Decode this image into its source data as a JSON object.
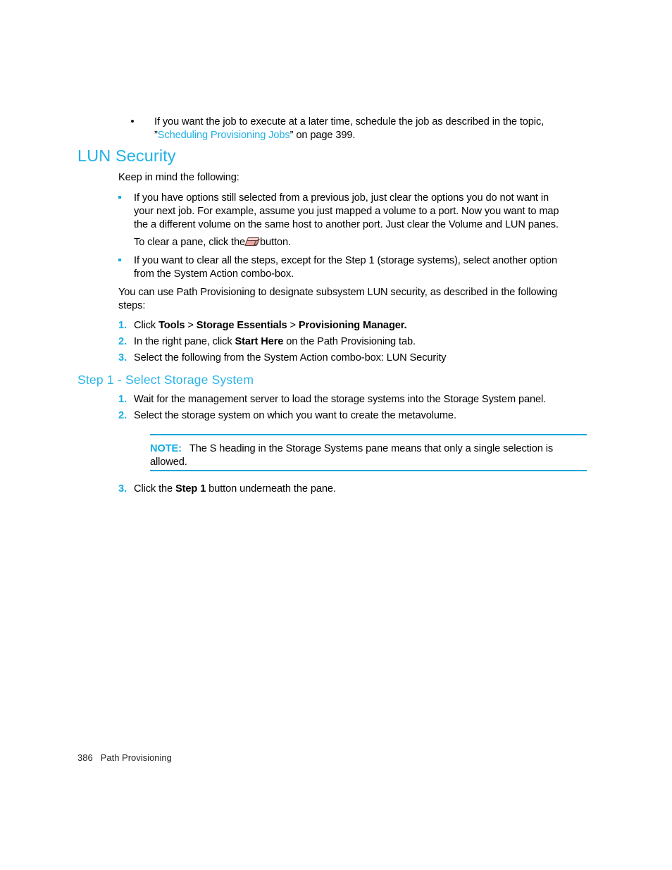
{
  "page": {
    "footer_page_number": "386",
    "footer_chapter": "Path Provisioning",
    "colors": {
      "heading_cyan": "#1fb2e6",
      "subheading_cyan": "#2ab4e8",
      "link_cyan": "#1fb0e5",
      "list_marker_cyan": "#17ace0",
      "rule_cyan": "#0fa5d8",
      "body_black": "#000000",
      "eraser_pink": "#e8a8a2"
    }
  },
  "intro_bullet": {
    "marker": "•",
    "line1_pre": "If you want the job to execute at a later time, schedule the job as described in the topic,",
    "line2_quote_open": "”",
    "line2_link": "Scheduling Provisioning Jobs",
    "line2_post": "” on page 399."
  },
  "section": {
    "heading": "LUN Security",
    "intro": "Keep in mind the following:"
  },
  "bullets": [
    {
      "marker": "•",
      "line1": "If you have options still selected from a previous job, just clear the options you do not want in",
      "line2": "your next job. For example, assume you just mapped a volume to a port. Now you want to map",
      "line3": "the a different volume on the same host to another port. Just clear the Volume and LUN panes.",
      "sub_pre": "To clear a pane, click the",
      "sub_icon": "eraser-icon",
      "sub_post": "button."
    },
    {
      "marker": "•",
      "line1": "If you want to clear all the steps, except for the Step 1 (storage systems), select another option",
      "line2": "from the System Action combo-box."
    }
  ],
  "paragraph": {
    "line1": "You can use Path Provisioning to designate subsystem LUN security, as described in the following",
    "line2": "steps:"
  },
  "steps_main": [
    {
      "number": "1.",
      "pre": "Click ",
      "bold1": "Tools",
      "sep1": " > ",
      "bold2": "Storage Essentials",
      "sep2": " > ",
      "bold3": "Provisioning Manager."
    },
    {
      "number": "2.",
      "pre": "In the right pane, click ",
      "bold1": "Start Here",
      "post": " on the Path Provisioning tab."
    },
    {
      "number": "3.",
      "pre": "Select the following from the System Action combo-box: LUN Security"
    }
  ],
  "step1_section": {
    "heading": "Step 1 - Select Storage System",
    "items": [
      {
        "number": "1.",
        "text": "Wait for the management server to load the storage systems into the Storage System panel."
      },
      {
        "number": "2.",
        "text": "Select the storage system on which you want to create the metavolume."
      }
    ],
    "note": {
      "label": "NOTE:",
      "line1": "The S heading in the Storage Systems pane means that only a single selection is",
      "line2": "allowed."
    },
    "item_after_note": {
      "number": "3.",
      "pre": "Click the ",
      "bold1": "Step 1",
      "post": " button underneath the pane."
    }
  }
}
